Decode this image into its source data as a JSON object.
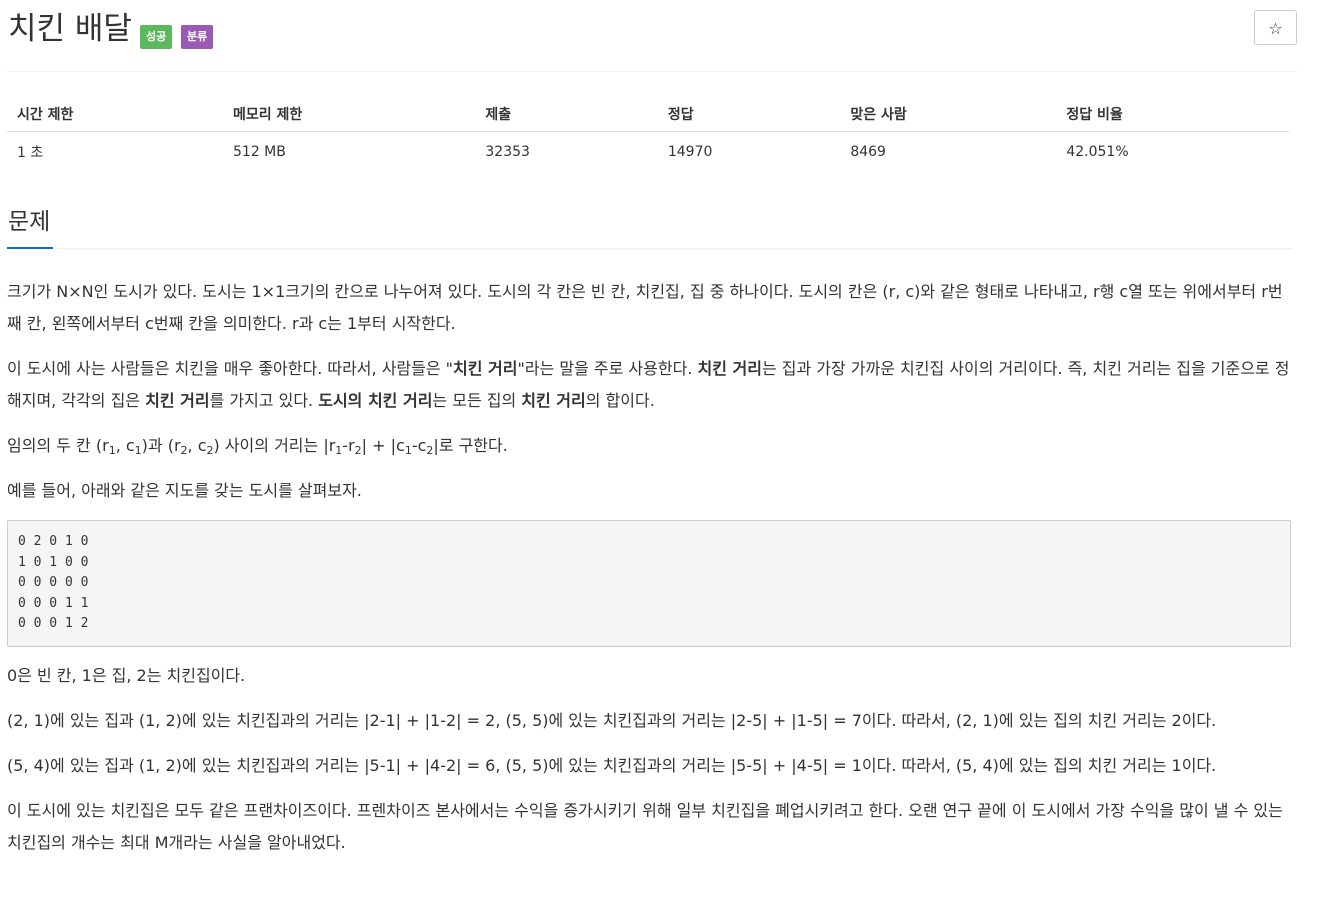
{
  "problem": {
    "title": "치킨 배달",
    "badges": {
      "status": "성공",
      "category": "분류"
    },
    "star_icon": "star-outline-icon"
  },
  "info": {
    "headers": [
      "시간 제한",
      "메모리 제한",
      "제출",
      "정답",
      "맞은 사람",
      "정답 비율"
    ],
    "values": [
      "1 초",
      "512 MB",
      "32353",
      "14970",
      "8469",
      "42.051%"
    ]
  },
  "section": {
    "title": "문제",
    "p1": "크기가 N×N인 도시가 있다. 도시는 1×1크기의 칸으로 나누어져 있다. 도시의 각 칸은 빈 칸, 치킨집, 집 중 하나이다. 도시의 칸은 (r, c)와 같은 형태로 나타내고, r행 c열 또는 위에서부터 r번째 칸, 왼쪽에서부터 c번째 칸을 의미한다. r과 c는 1부터 시작한다.",
    "p2": {
      "a": "이 도시에 사는 사람들은 치킨을 매우 좋아한다. 따라서, 사람들은 \"",
      "b": "치킨 거리",
      "c": "\"라는 말을 주로 사용한다. ",
      "d": "치킨 거리",
      "e": "는 집과 가장 가까운 치킨집 사이의 거리이다. 즉, 치킨 거리는 집을 기준으로 정해지며, 각각의 집은 ",
      "f": "치킨 거리",
      "g": "를 가지고 있다. ",
      "h": "도시의 치킨 거리",
      "i": "는 모든 집의 ",
      "j": "치킨 거리",
      "k": "의 합이다."
    },
    "p3": {
      "a": "임의의 두 칸 (r",
      "s1": "1",
      "b": ", c",
      "s2": "1",
      "c": ")과 (r",
      "s3": "2",
      "d": ", c",
      "s4": "2",
      "e": ") 사이의 거리는 |r",
      "s5": "1",
      "f": "-r",
      "s6": "2",
      "g": "| + |c",
      "s7": "1",
      "h": "-c",
      "s8": "2",
      "i": "|로 구한다."
    },
    "p4": "예를 들어, 아래와 같은 지도를 갖는 도시를 살펴보자.",
    "grid": "0 2 0 1 0\n1 0 1 0 0\n0 0 0 0 0\n0 0 0 1 1\n0 0 0 1 2",
    "p5": "0은 빈 칸, 1은 집, 2는 치킨집이다.",
    "p6": "(2, 1)에 있는 집과 (1, 2)에 있는 치킨집과의 거리는 |2-1| + |1-2| = 2, (5, 5)에 있는 치킨집과의 거리는 |2-5| + |1-5| = 7이다. 따라서, (2, 1)에 있는 집의 치킨 거리는 2이다.",
    "p7": "(5, 4)에 있는 집과 (1, 2)에 있는 치킨집과의 거리는 |5-1| + |4-2| = 6, (5, 5)에 있는 치킨집과의 거리는 |5-5| + |4-5| = 1이다. 따라서, (5, 4)에 있는 집의 치킨 거리는 1이다.",
    "p8": "이 도시에 있는 치킨집은 모두 같은 프랜차이즈이다. 프렌차이즈 본사에서는 수익을 증가시키기 위해 일부 치킨집을 폐업시키려고 한다. 오랜 연구 끝에 이 도시에서 가장 수익을 많이 낼 수 있는  치킨집의 개수는 최대 M개라는 사실을 알아내었다."
  }
}
